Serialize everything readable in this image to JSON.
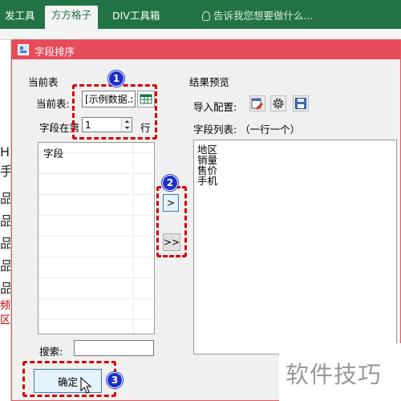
{
  "ribbon": {
    "tabs": [
      {
        "label": "发工具",
        "active": false
      },
      {
        "label": "方方格子",
        "active": true
      },
      {
        "label": "DIV工具箱",
        "active": false
      }
    ],
    "search_placeholder": "告诉我您想要做什么..."
  },
  "sheet_fragments": [
    "H",
    "手",
    "品",
    "品",
    "品",
    "品",
    "品",
    "频",
    "区"
  ],
  "dialog": {
    "title": "字段排序",
    "left_group": {
      "label": "当前表",
      "table_label": "当前表:",
      "table_value": "[示例数据.xl",
      "row_label_prefix": "字段在第",
      "row_value": "1",
      "row_label_suffix": "行",
      "fields": [
        "字段"
      ],
      "search_label": "搜索:",
      "search_value": ""
    },
    "move_buttons": {
      "move_one": ">",
      "move_all": ">>"
    },
    "right_group": {
      "label": "结果预览",
      "import_label": "导入配置:",
      "list_label": "字段列表: （一行一个）",
      "fields": [
        "地区",
        "销量",
        "售价",
        "手机"
      ]
    },
    "ok_button": "确定"
  },
  "callouts": [
    "1",
    "2",
    "3"
  ],
  "watermark": "软件技巧",
  "colors": {
    "ribbon": "#217346",
    "dialog_title": "#e84c5a",
    "callout": "#d40000",
    "step_badge": "#1c2fc8"
  }
}
